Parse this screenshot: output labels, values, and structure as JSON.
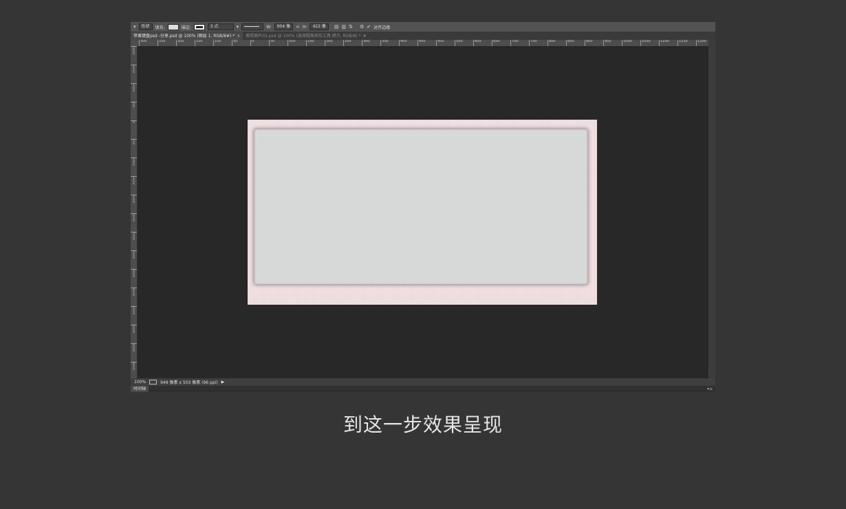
{
  "options_bar": {
    "mode_label": "形状",
    "fill_label": "填充:",
    "stroke_label": "描边:",
    "stroke_width": "3 点",
    "width_label": "W:",
    "width_value": "904 像",
    "height_label": "H:",
    "height_value": "422 像",
    "align_edges_label": "对齐边缘"
  },
  "tabs": [
    {
      "label": "苹果键盘psd -分享.psd @ 100% (图层 1, RGB/8#) *",
      "active": true
    },
    {
      "label": "教程图片01.psd @ 100% (选择圆角矩形工具 拷贝, RGB/8) *",
      "active": false
    }
  ],
  "ruler_h": [
    "300",
    "250",
    "200",
    "150",
    "100",
    "50",
    "0",
    "50",
    "100",
    "150",
    "200",
    "250",
    "300",
    "350",
    "400",
    "450",
    "500",
    "550",
    "600",
    "650",
    "700",
    "750",
    "800",
    "850",
    "900",
    "950",
    "1000",
    "1050",
    "1100",
    "1150",
    "1200"
  ],
  "ruler_v": [
    "200",
    "150",
    "100",
    "50",
    "0",
    "50",
    "100",
    "150",
    "200",
    "250",
    "300",
    "350",
    "400",
    "450",
    "500",
    "550",
    "600",
    "650"
  ],
  "status": {
    "zoom": "100%",
    "doc_info": "949 像素 x 503 像素 (96 ppi)"
  },
  "timeline": {
    "label": "时间轴"
  },
  "caption": "到这一步效果呈现",
  "colors": {
    "canvas": "#efe0e2",
    "panel": "#d7d9d8",
    "workspace": "#282828",
    "page_bg": "#353535"
  }
}
